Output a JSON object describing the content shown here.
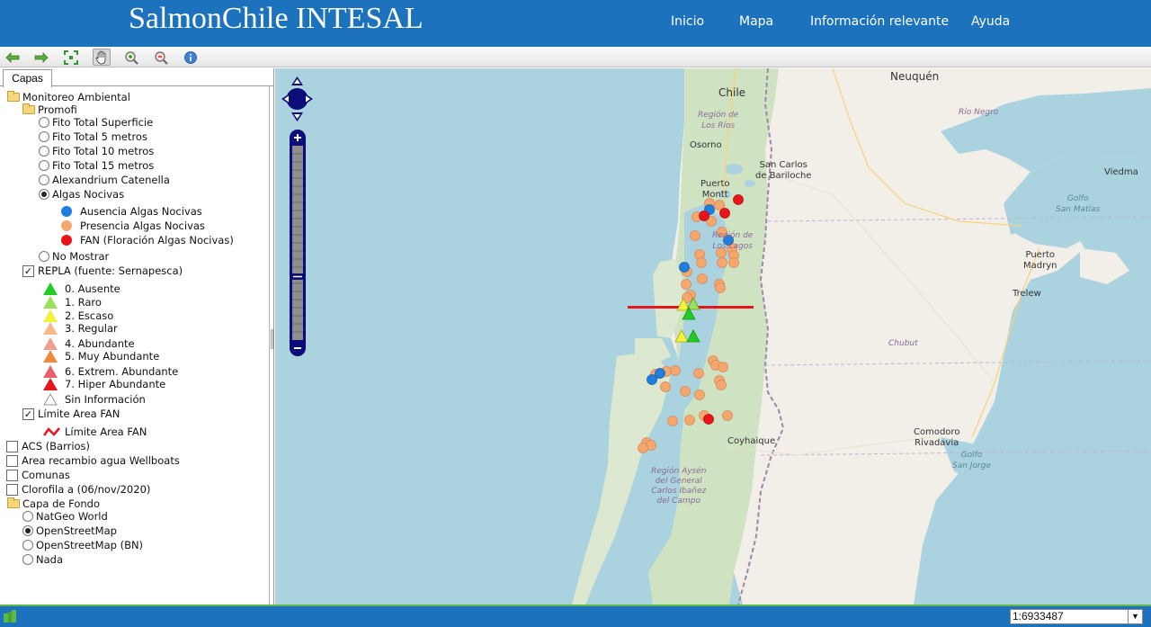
{
  "header": {
    "logo": "SalmonChile INTESAL",
    "nav": [
      "Inicio",
      "Mapa",
      "Información relevante",
      "Ayuda"
    ]
  },
  "sidebar": {
    "tab": "Capas",
    "tree": {
      "monitoreo": "Monitoreo Ambiental",
      "promofi": "Promofi",
      "fito_superficie": "Fito Total Superficie",
      "fito_5": "Fito Total 5 metros",
      "fito_10": "Fito Total 10 metros",
      "fito_15": "Fito Total 15 metros",
      "alexandrium": "Alexandrium Catenella",
      "algas": "Algas Nocivas",
      "legend_ausencia": "Ausencia Algas Nocivas",
      "legend_presencia": "Presencia Algas Nocivas",
      "legend_fan": "FAN (Floración Algas Nocivas)",
      "no_mostrar": "No Mostrar",
      "repla": "REPLA (fuente: Sernapesca)",
      "repla_levels": [
        "0. Ausente",
        "1. Raro",
        "2. Escaso",
        "3. Regular",
        "4. Abundante",
        "5. Muy Abundante",
        "6. Extrem. Abundante",
        "7. Hiper Abundante",
        "Sin Información"
      ],
      "limite": "Límite Area FAN",
      "limite_legend": "Límite Area FAN",
      "acs": "ACS (Barrios)",
      "wellboats": "Area recambio agua Wellboats",
      "comunas": "Comunas",
      "clorofila": "Clorofila a (06/nov/2020)",
      "capa_fondo": "Capa de Fondo",
      "natgeo": "NatGeo World",
      "osm": "OpenStreetMap",
      "osm_bn": "OpenStreetMap (BN)",
      "nada": "Nada"
    }
  },
  "colors": {
    "header": "#1c72bd",
    "ausencia": "#1e7fe0",
    "presencia": "#f4a86e",
    "fan": "#e8141b",
    "repla": [
      "#22cc22",
      "#9be05a",
      "#f3f33a",
      "#f5b98a",
      "#ef9f8f",
      "#f08a3a",
      "#e9626a",
      "#e8141b",
      "#ffffff"
    ]
  },
  "map": {
    "labels": {
      "chile": "Chile",
      "neuquen": "Neuquén",
      "region_rios": "Región de\nLos Ríos",
      "rio_negro": "Río Negro",
      "osorno": "Osorno",
      "san_carlos": "San Carlos\nde Bariloche",
      "puerto_montt": "Puerto\nMontt",
      "viedma": "Viedma",
      "golfo_matias": "Golfo\nSan Matías",
      "region_lagos": "Región de\nLos Lagos",
      "puerto_madryn": "Puerto\nMadryn",
      "trelew": "Trelew",
      "chubut": "Chubut",
      "coyhaique": "Coyhaique",
      "comodoro": "Comodoro\nRivadavia",
      "golfo_jorge": "Golfo\nSan Jorge",
      "region_aysen": "Región Aysén\ndel General\nCarlos Ibañez\ndel Campo"
    }
  },
  "footer": {
    "scale": "1:6933487"
  }
}
